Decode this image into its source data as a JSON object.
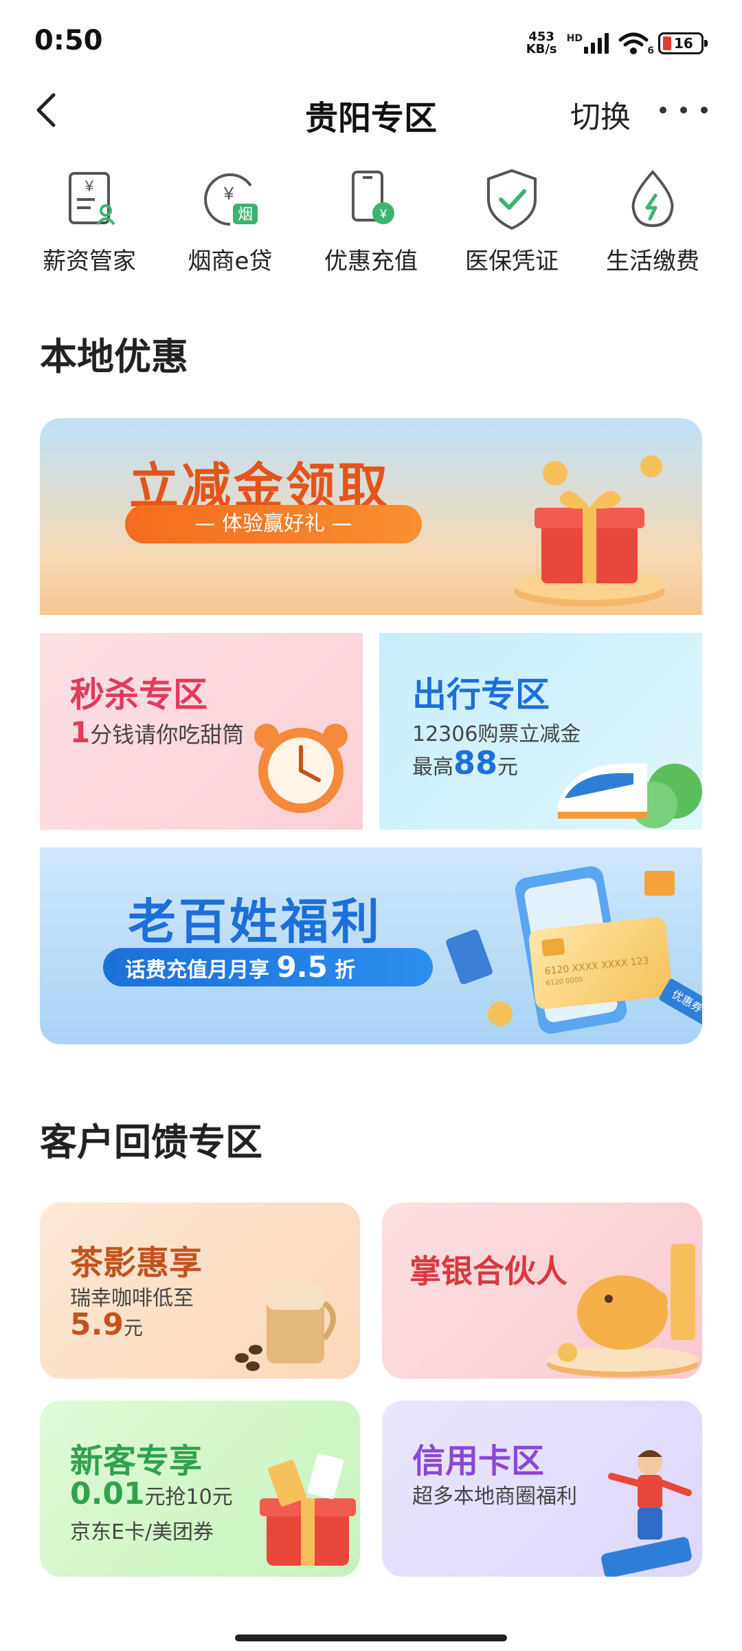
{
  "status_bar": {
    "time": "0:50",
    "net_speed_value": "453",
    "net_speed_unit": "KB/s",
    "network_type": "HD",
    "wifi_badge": "6",
    "battery_level": "16"
  },
  "nav": {
    "title": "贵阳专区",
    "switch_label": "切换"
  },
  "services": [
    {
      "label": "薪资管家",
      "icon": "payroll-icon",
      "glyph": "¥"
    },
    {
      "label": "烟商e贷",
      "icon": "tobacco-loan-icon",
      "glyph": "¥",
      "badge": "烟"
    },
    {
      "label": "优惠充值",
      "icon": "recharge-icon",
      "glyph": "¥"
    },
    {
      "label": "医保凭证",
      "icon": "shield-check-icon"
    },
    {
      "label": "生活缴费",
      "icon": "utility-drop-icon"
    }
  ],
  "local_deals": {
    "title": "本地优惠",
    "banner_cash": {
      "title": "立减金领取",
      "pill": "— 体验赢好礼 —"
    },
    "flash_sale": {
      "title": "秒杀专区",
      "num": "1",
      "sub": "分钱请你吃甜筒"
    },
    "travel": {
      "title": "出行专区",
      "line1": "12306购票立减金",
      "line2_prefix": "最高",
      "line2_num": "88",
      "line2_suffix": "元"
    },
    "welfare": {
      "title": "老百姓福利",
      "pill_text": "话费充值月月享",
      "pill_num": "9.5",
      "pill_suffix": "折",
      "card_number": "6120 XXXX XXXX 123",
      "card_sub": "6120 0000",
      "tag": "优惠券"
    }
  },
  "feedback": {
    "title": "客户回馈专区",
    "tea": {
      "title": "茶影惠享",
      "line1": "瑞幸咖啡低至",
      "num": "5.9",
      "unit": "元"
    },
    "partner": {
      "title": "掌银合伙人"
    },
    "newcomer": {
      "title": "新客专享",
      "num": "0.01",
      "line1_suffix": "元抢10元",
      "line2": "京东E卡/美团券"
    },
    "credit": {
      "title": "信用卡区",
      "line1": "超多本地商圈福利"
    }
  },
  "colors": {
    "orange_title": "#e5541a",
    "pink_title": "#e23a5b",
    "blue_title": "#1d6fd9",
    "green_title": "#2fa24a",
    "purple_title": "#8a48d6",
    "brown_title": "#c1541e",
    "red_title": "#d63a3f"
  }
}
